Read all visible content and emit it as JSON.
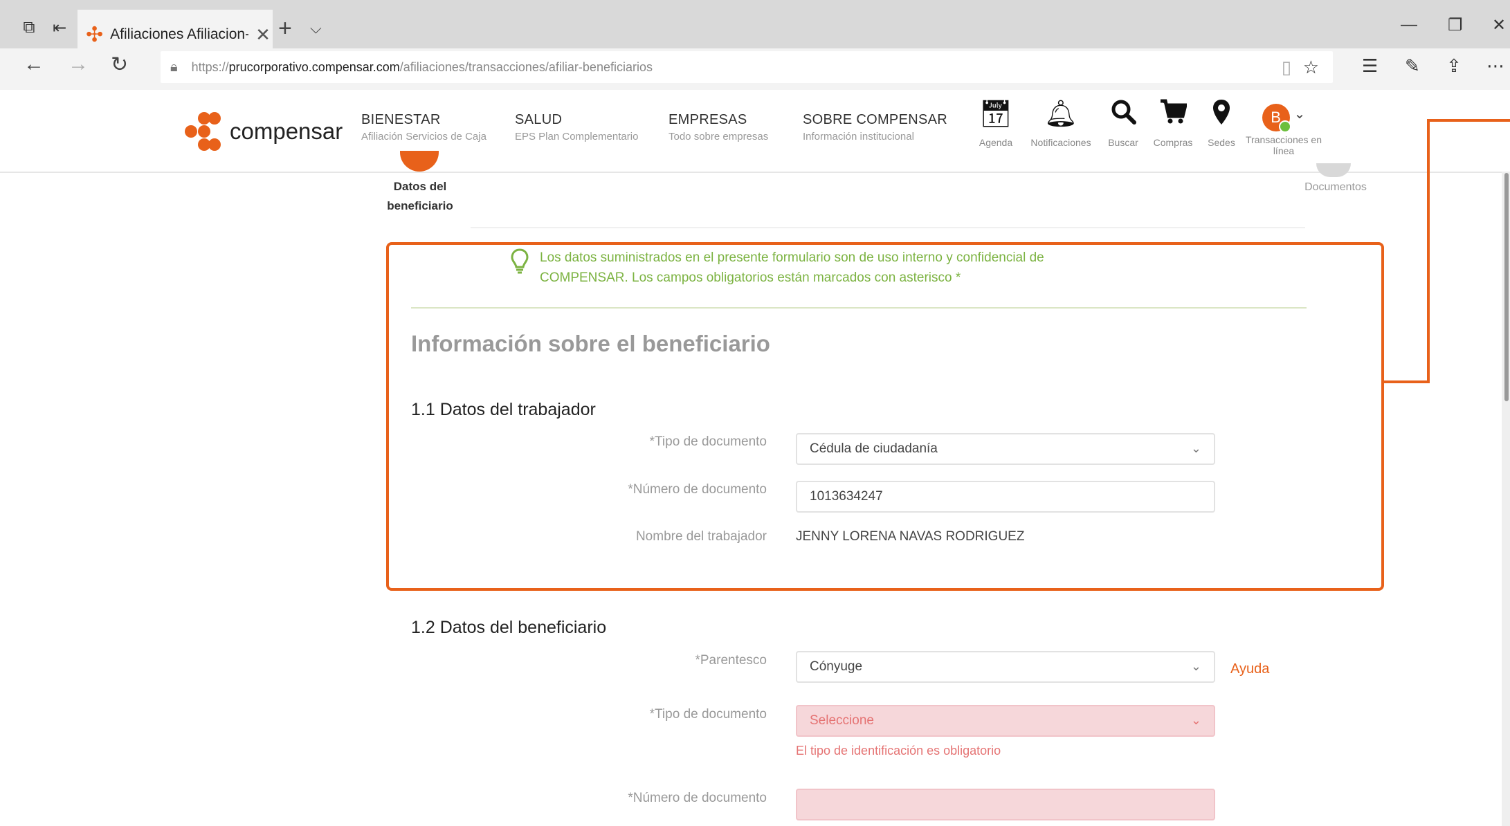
{
  "browser": {
    "tab_title": "Afiliaciones Afiliacion-b",
    "tab_close": "✕",
    "new_tab": "+",
    "tab_list": "⌵",
    "url_scheme": "https://",
    "url_host": "prucorporativo.compensar.com",
    "url_path": "/afiliaciones/transacciones/afiliar-beneficiarios"
  },
  "site": {
    "logo_text": "compensar",
    "nav": [
      {
        "title": "BIENESTAR",
        "sub": "Afiliación Servicios de Caja"
      },
      {
        "title": "SALUD",
        "sub": "EPS Plan Complementario"
      },
      {
        "title": "EMPRESAS",
        "sub": "Todo sobre empresas"
      },
      {
        "title": "SOBRE COMPENSAR",
        "sub": "Información institucional"
      }
    ],
    "icons": [
      {
        "name": "calendar-icon",
        "label": "Agenda"
      },
      {
        "name": "bell-icon",
        "label": "Notificaciones"
      },
      {
        "name": "search-icon",
        "label": "Buscar"
      },
      {
        "name": "cart-icon",
        "label": "Compras"
      },
      {
        "name": "location-pin-icon",
        "label": "Sedes"
      }
    ],
    "avatar_letter": "B",
    "transactions_label": "Transacciones en línea"
  },
  "stepper": {
    "current_label": "Datos del beneficiario",
    "last_label": "Documentos"
  },
  "notice": {
    "text": "Los datos suministrados en el presente formulario son de uso interno y confidencial de COMPENSAR. Los campos obligatorios están marcados con asterisco *"
  },
  "form": {
    "section_title": "Información sobre el beneficiario",
    "worker": {
      "title": "1.1 Datos del trabajador",
      "doc_type_label": "*Tipo de documento",
      "doc_type_value": "Cédula de ciudadanía",
      "doc_number_label": "*Número de documento",
      "doc_number_value": "1013634247",
      "name_label": "Nombre del trabajador",
      "name_value": "JENNY LORENA NAVAS RODRIGUEZ"
    },
    "beneficiary": {
      "title": "1.2 Datos del beneficiario",
      "relationship_label": "*Parentesco",
      "relationship_value": "Cónyuge",
      "help_link": "Ayuda",
      "doc_type_label": "*Tipo de documento",
      "doc_type_value": "Seleccione",
      "doc_type_error": "El tipo de identificación es obligatorio",
      "doc_number_label": "*Número de documento",
      "doc_number_value": ""
    }
  },
  "colors": {
    "accent": "#e8611a",
    "notice_green": "#7cb342",
    "error_bg": "#f6d7da",
    "error_text": "#e57373"
  }
}
